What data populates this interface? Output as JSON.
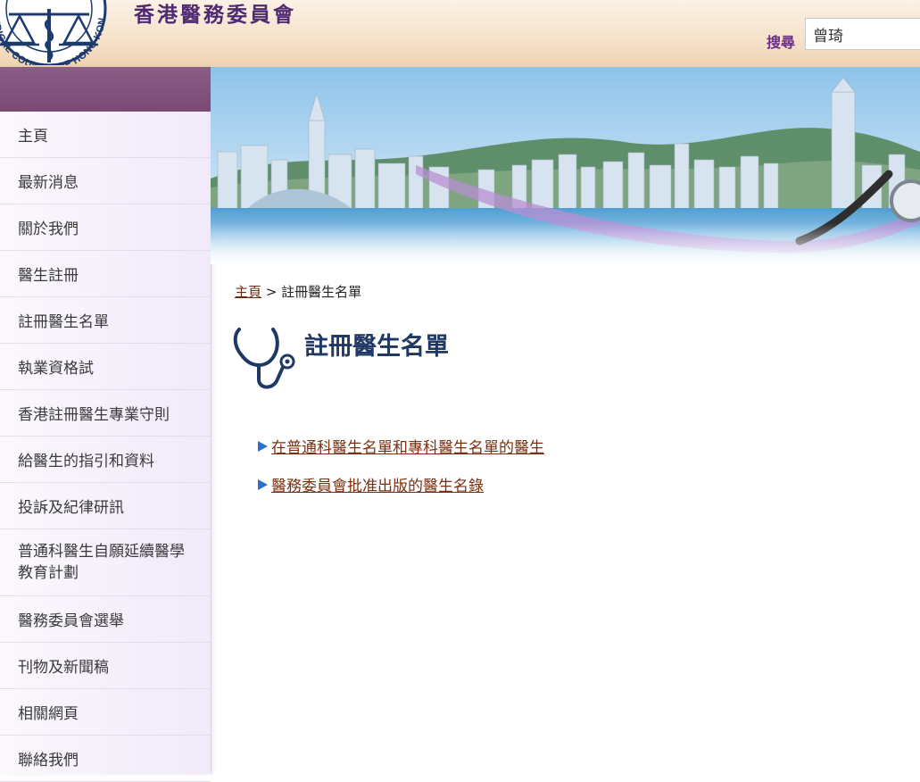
{
  "header": {
    "site_title": "香港醫務委員會",
    "logo_text": "MEDICAL COUNCIL OF HONG KONG",
    "search_label": "搜尋",
    "search_value": "曾琦"
  },
  "sidebar": {
    "items": [
      {
        "label": "主頁"
      },
      {
        "label": "最新消息"
      },
      {
        "label": "關於我們"
      },
      {
        "label": "醫生註冊"
      },
      {
        "label": "註冊醫生名單"
      },
      {
        "label": "執業資格試"
      },
      {
        "label": "香港註冊醫生專業守則"
      },
      {
        "label": "給醫生的指引和資料"
      },
      {
        "label": "投訴及紀律研訊"
      },
      {
        "label": "普通科醫生自願延續醫學教育計劃"
      },
      {
        "label": "醫務委員會選舉"
      },
      {
        "label": "刊物及新聞稿"
      },
      {
        "label": "相關網頁"
      },
      {
        "label": "聯絡我們"
      }
    ]
  },
  "breadcrumb": {
    "home": "主頁",
    "separator": ">",
    "current": "註冊醫生名單"
  },
  "main": {
    "title": "註冊醫生名單",
    "links": [
      {
        "label": "在普通科醫生名單和專科醫生名單的醫生"
      },
      {
        "label": "醫務委員會批准出版的醫生名錄"
      }
    ]
  },
  "colors": {
    "sidebar_header": "#7a4a74",
    "title_blue": "#1f3864",
    "link_brown": "#7a3010",
    "arrow_blue": "#2a6fd1"
  },
  "icons": [
    "logo-emblem",
    "stethoscope-icon",
    "arrow-right-icon"
  ]
}
